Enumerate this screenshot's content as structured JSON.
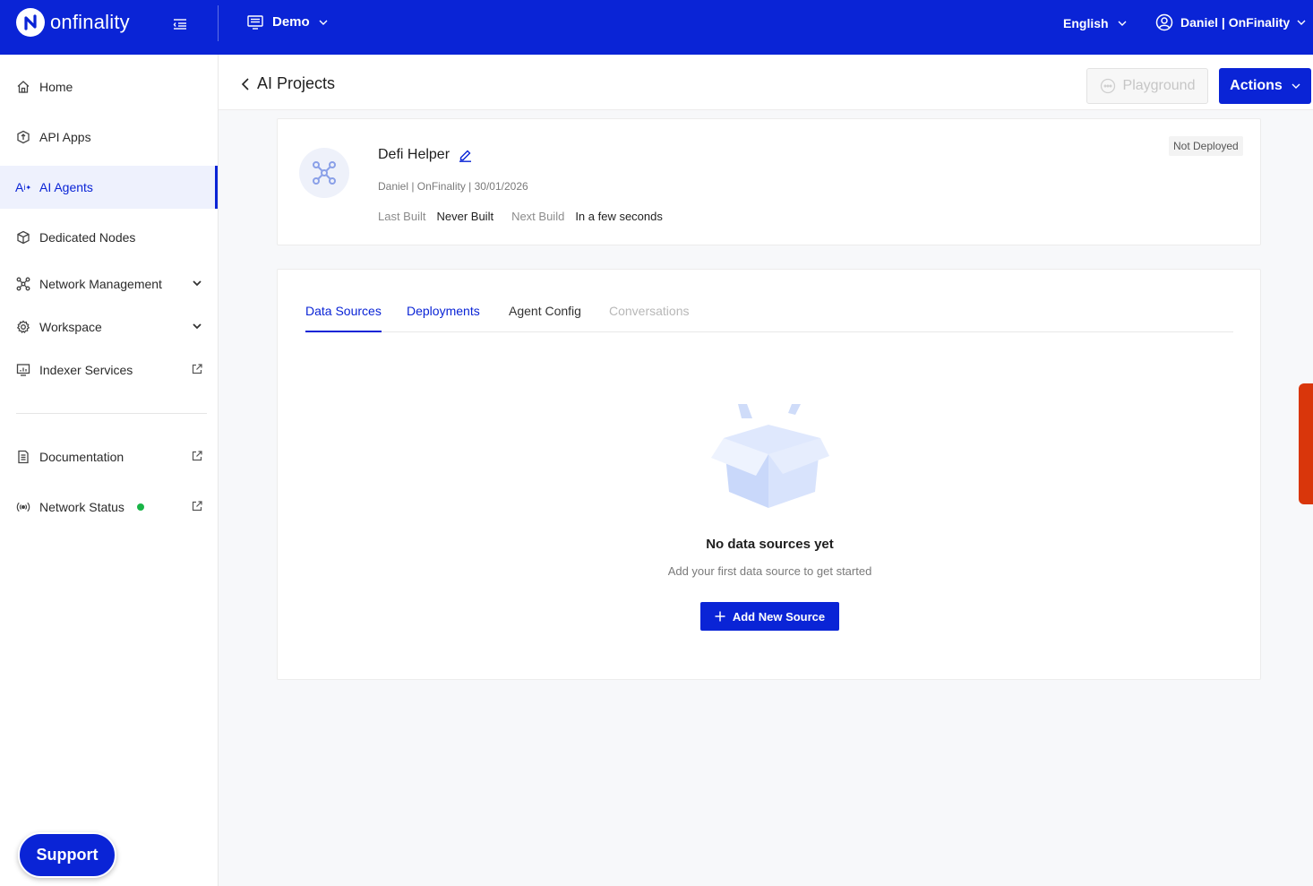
{
  "brand": {
    "name": "onfinality"
  },
  "topbar": {
    "project": "Demo",
    "language": "English",
    "user": "Daniel | OnFinality"
  },
  "sidebar": {
    "items": [
      {
        "label": "Home",
        "icon": "home-icon"
      },
      {
        "label": "API Apps",
        "icon": "api-icon"
      },
      {
        "label": "AI Agents",
        "icon": "ai-sparkle-icon",
        "active": true
      },
      {
        "label": "Dedicated Nodes",
        "icon": "cube-icon"
      },
      {
        "label": "Network Management",
        "icon": "network-icon"
      },
      {
        "label": "Workspace",
        "icon": "gear-icon"
      },
      {
        "label": "Indexer Services",
        "icon": "monitor-icon"
      },
      {
        "label": "Documentation",
        "icon": "document-icon"
      },
      {
        "label": "Network Status",
        "icon": "broadcast-icon",
        "status_color": "#19b447"
      }
    ],
    "support_label": "Support"
  },
  "header": {
    "back_label": "AI Projects",
    "playground_label": "Playground",
    "actions_label": "Actions"
  },
  "agent": {
    "name": "Defi Helper",
    "meta": "Daniel | OnFinality | 30/01/2026",
    "last_built_label": "Last Built",
    "last_built_value": "Never Built",
    "next_build_label": "Next Build",
    "next_build_value": "In a few seconds",
    "status": "Not Deployed"
  },
  "tabs": [
    {
      "label": "Data Sources",
      "state": "active"
    },
    {
      "label": "Deployments",
      "state": "link"
    },
    {
      "label": "Agent Config",
      "state": "normal"
    },
    {
      "label": "Conversations",
      "state": "disabled"
    }
  ],
  "empty_state": {
    "title": "No data sources yet",
    "subtitle": "Add your first data source to get started",
    "button": "Add New Source"
  },
  "colors": {
    "primary": "#0a24d6",
    "feedback": "#d9360b"
  }
}
